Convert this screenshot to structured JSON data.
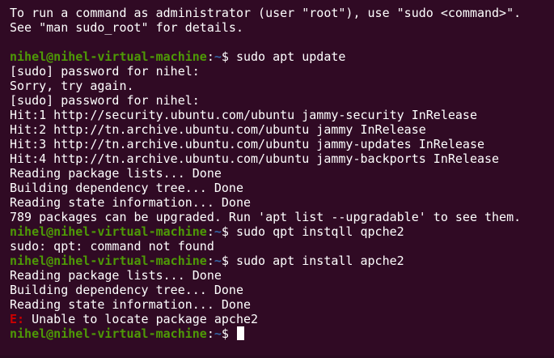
{
  "terminal": {
    "lines": [
      {
        "type": "text",
        "text": "To run a command as administrator (user \"root\"), use \"sudo <command>\"."
      },
      {
        "type": "text",
        "text": "See \"man sudo_root\" for details."
      },
      {
        "type": "blank",
        "text": ""
      },
      {
        "type": "prompt",
        "user": "nihel@nihel-virtual-machine",
        "sep": ":",
        "path": "~",
        "sigil": "$ ",
        "command": "sudo apt update"
      },
      {
        "type": "text",
        "text": "[sudo] password for nihel:"
      },
      {
        "type": "text",
        "text": "Sorry, try again."
      },
      {
        "type": "text",
        "text": "[sudo] password for nihel:"
      },
      {
        "type": "text",
        "text": "Hit:1 http://security.ubuntu.com/ubuntu jammy-security InRelease"
      },
      {
        "type": "text",
        "text": "Hit:2 http://tn.archive.ubuntu.com/ubuntu jammy InRelease"
      },
      {
        "type": "text",
        "text": "Hit:3 http://tn.archive.ubuntu.com/ubuntu jammy-updates InRelease"
      },
      {
        "type": "text",
        "text": "Hit:4 http://tn.archive.ubuntu.com/ubuntu jammy-backports InRelease"
      },
      {
        "type": "text",
        "text": "Reading package lists... Done"
      },
      {
        "type": "text",
        "text": "Building dependency tree... Done"
      },
      {
        "type": "text",
        "text": "Reading state information... Done"
      },
      {
        "type": "text",
        "text": "789 packages can be upgraded. Run 'apt list --upgradable' to see them."
      },
      {
        "type": "prompt",
        "user": "nihel@nihel-virtual-machine",
        "sep": ":",
        "path": "~",
        "sigil": "$ ",
        "command": "sudo qpt instqll qpche2"
      },
      {
        "type": "text",
        "text": "sudo: qpt: command not found"
      },
      {
        "type": "prompt",
        "user": "nihel@nihel-virtual-machine",
        "sep": ":",
        "path": "~",
        "sigil": "$ ",
        "command": "sudo apt install apche2"
      },
      {
        "type": "text",
        "text": "Reading package lists... Done"
      },
      {
        "type": "text",
        "text": "Building dependency tree... Done"
      },
      {
        "type": "text",
        "text": "Reading state information... Done"
      },
      {
        "type": "error",
        "prefix": "E:",
        "text": " Unable to locate package apche2"
      },
      {
        "type": "prompt-active",
        "user": "nihel@nihel-virtual-machine",
        "sep": ":",
        "path": "~",
        "sigil": "$ ",
        "command": ""
      }
    ]
  },
  "colors": {
    "background": "#300a24",
    "prompt_user": "#4e9a06",
    "prompt_path": "#3465a4",
    "error": "#cc0000",
    "text": "#ffffff"
  }
}
